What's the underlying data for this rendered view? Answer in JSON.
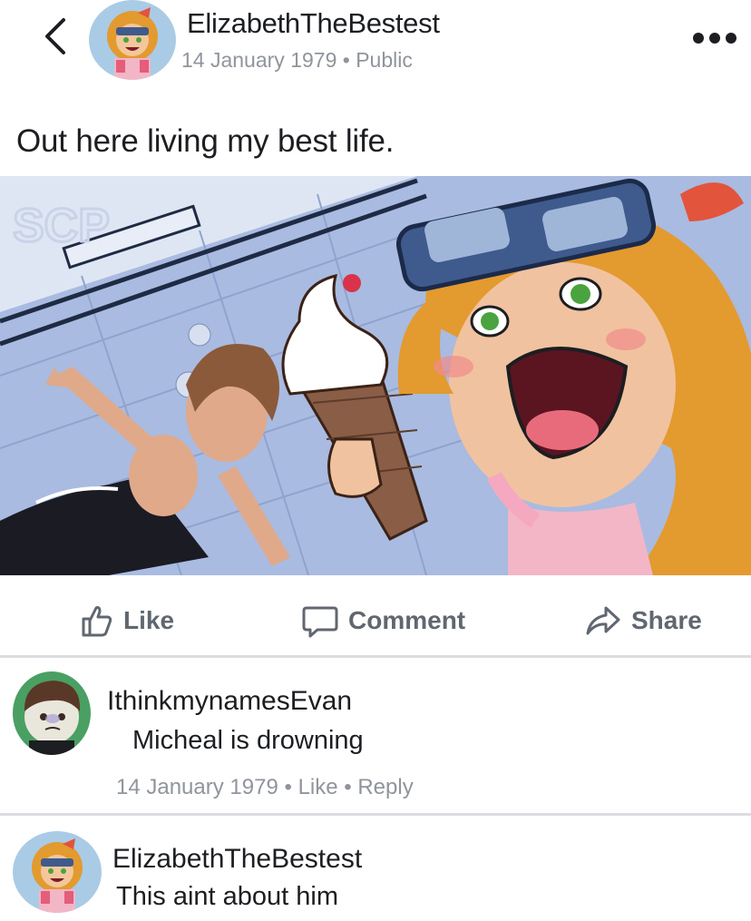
{
  "post": {
    "author": "ElizabethTheBestest",
    "date": "14 January 1979",
    "separator": " • ",
    "visibility": "Public",
    "text": "Out here living my best life.",
    "image_watermark": "SCP"
  },
  "icons": {
    "back": "chevron-left-icon",
    "more": "more-dots-icon",
    "like": "thumbs-up-icon",
    "comment": "speech-bubble-icon",
    "share": "share-arrow-icon"
  },
  "actions": {
    "like_label": "Like",
    "comment_label": "Comment",
    "share_label": "Share"
  },
  "comments": [
    {
      "author": "IthinkmynamesEvan",
      "text": "Micheal is drowning",
      "date": "14 January 1979",
      "sep1": " • ",
      "like": "Like",
      "sep2": " • ",
      "reply": "Reply"
    },
    {
      "author": "ElizabethTheBestest",
      "text": "This aint about him"
    }
  ],
  "colors": {
    "text": "#1c1e21",
    "meta": "#90949c",
    "action": "#606770",
    "divider": "#dadde1"
  }
}
